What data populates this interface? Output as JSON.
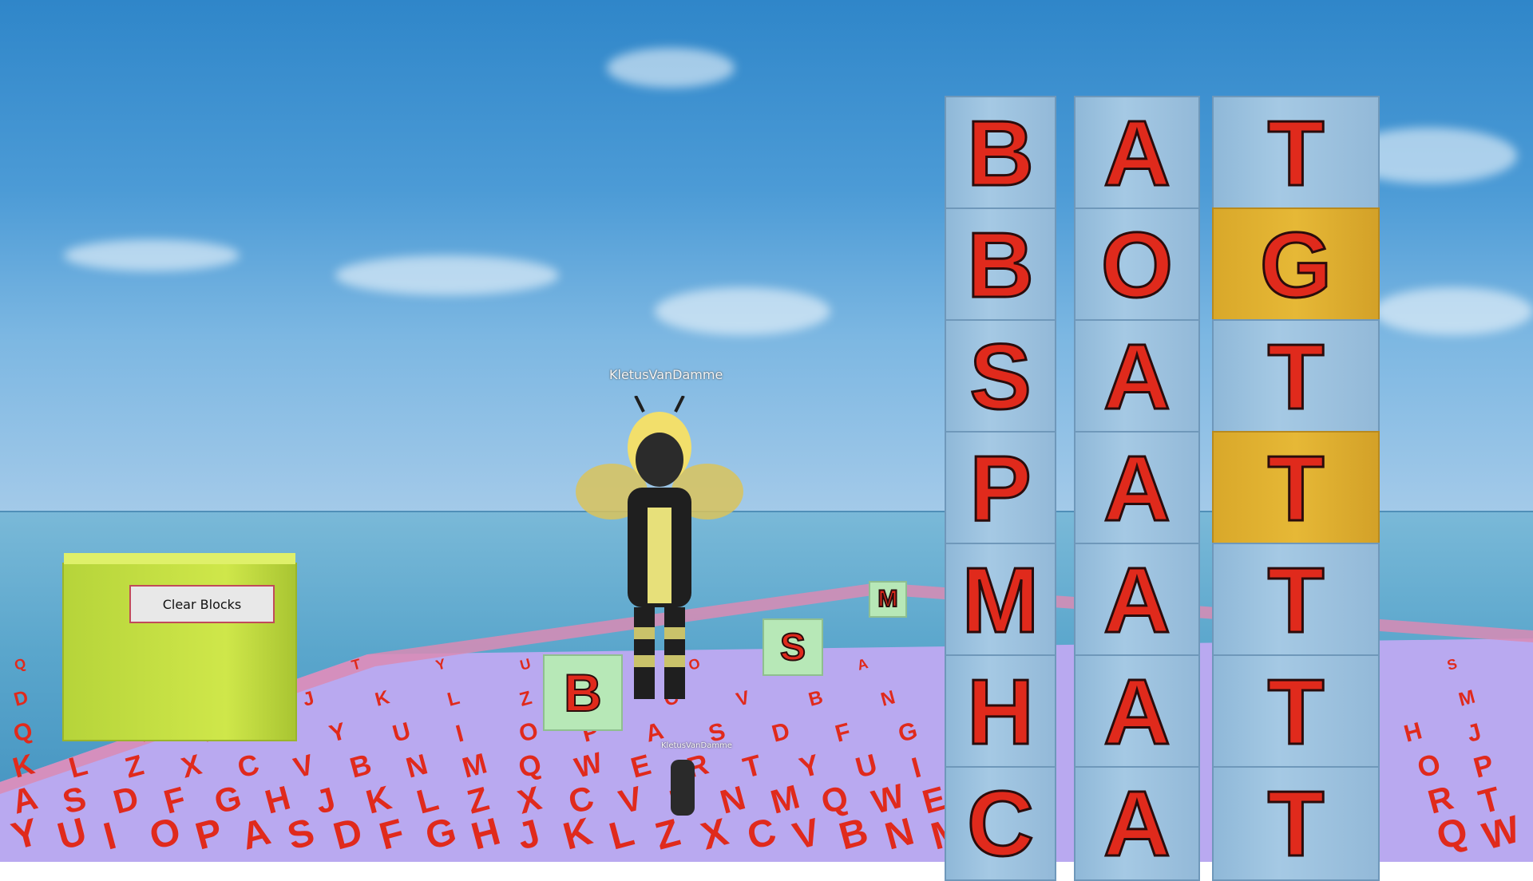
{
  "game": {
    "player_name": "KletusVanDamme",
    "minimap_name": "KletusVanDamme",
    "clear_button_label": "Clear Blocks",
    "ground_cubes": [
      {
        "name": "cube-b",
        "label": "B"
      },
      {
        "name": "cube-s",
        "label": "S"
      },
      {
        "name": "cube-m",
        "label": "M"
      }
    ],
    "towers": [
      {
        "name": "tower-1",
        "letters": [
          "B",
          "B",
          "S",
          "P",
          "M",
          "H",
          "C"
        ]
      },
      {
        "name": "tower-2",
        "letters": [
          "A",
          "O",
          "A",
          "A",
          "A",
          "A",
          "A"
        ]
      },
      {
        "name": "tower-3",
        "letters": [
          "T",
          "G",
          "T",
          "T",
          "T",
          "T",
          "T"
        ],
        "gold_index": [
          1,
          3
        ]
      }
    ],
    "floor_letters": [
      "Q",
      "W",
      "E",
      "R",
      "T",
      "Y",
      "U",
      "I",
      "O",
      "P",
      "A",
      "S",
      "D",
      "F",
      "G",
      "H",
      "J",
      "K",
      "L",
      "Z",
      "X",
      "C",
      "V",
      "B",
      "N",
      "M"
    ],
    "colors": {
      "letter": "#e02a1c",
      "floor": "#b9a9f0",
      "tower": "#9fc4e2",
      "gold": "#e6b836",
      "sign": "#cfe74a"
    }
  }
}
